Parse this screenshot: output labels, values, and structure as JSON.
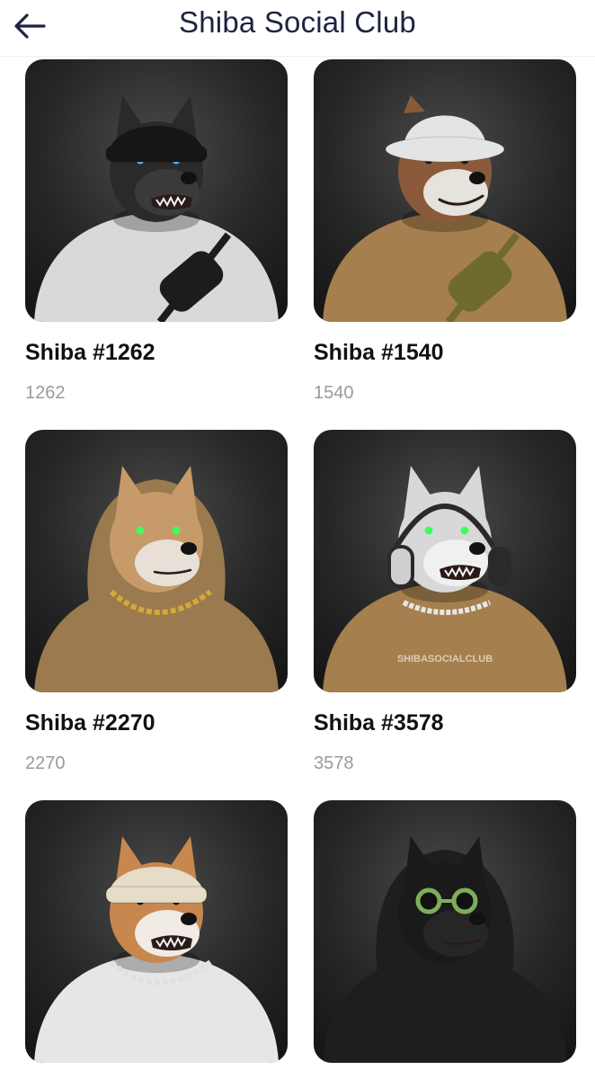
{
  "header": {
    "title": "Shiba Social Club",
    "back_icon": "arrow-left-icon"
  },
  "colors": {
    "title_text": "#1b2540",
    "card_title": "#111111",
    "card_subtitle": "#9a9a9a",
    "thumb_background": "#262626"
  },
  "items": [
    {
      "title": "Shiba #1262",
      "subtitle": "1262",
      "art": {
        "fur": "#2a2a2a",
        "muzzle": "#3a3a3a",
        "hat": "beanie",
        "hat_color": "#161616",
        "shirt": "#d9d9d9",
        "eyes": "#5ab4ff",
        "mouth": "snarl",
        "accessory": "bag",
        "accessory_color": "#1c1c1c"
      }
    },
    {
      "title": "Shiba #1540",
      "subtitle": "1540",
      "art": {
        "fur": "#8a5a3a",
        "muzzle": "#e6e2dc",
        "hat": "bucket",
        "hat_color": "#e4e4e4",
        "shirt": "#a57f4d",
        "eyes": "#1a1a1a",
        "mouth": "smile",
        "accessory": "bag",
        "accessory_color": "#6f6a2e"
      }
    },
    {
      "title": "Shiba #2270",
      "subtitle": "2270",
      "art": {
        "fur": "#c79a6a",
        "muzzle": "#e8e0d6",
        "hat": "hood",
        "hat_color": "#9a7a4e",
        "shirt": "#9a7a4e",
        "eyes": "#3cff5a",
        "mouth": "closed",
        "accessory": "chain",
        "accessory_color": "#d4a93a"
      }
    },
    {
      "title": "Shiba #3578",
      "subtitle": "3578",
      "art": {
        "fur": "#d8d8d8",
        "muzzle": "#f0f0f0",
        "hat": "none",
        "hat_color": "#d8d8d8",
        "shirt": "#a57f4d",
        "eyes": "#3cff5a",
        "mouth": "snarl",
        "accessory": "headphones",
        "accessory_color": "#2a2a2a",
        "shirt_text": "SHIBASOCIALCLUB"
      }
    },
    {
      "title": "",
      "subtitle": "",
      "art": {
        "fur": "#c7874e",
        "muzzle": "#f0ebe4",
        "hat": "beanie",
        "hat_color": "#e6dcc8",
        "shirt": "#e6e6e6",
        "eyes": "#1a1a1a",
        "mouth": "snarl",
        "accessory": "chain",
        "accessory_color": "#e0e0e0"
      }
    },
    {
      "title": "",
      "subtitle": "",
      "art": {
        "fur": "#1a1a1a",
        "muzzle": "#262626",
        "hat": "hood",
        "hat_color": "#1e1e1e",
        "shirt": "#1e1e1e",
        "eyes": "#1a1a1a",
        "mouth": "closed",
        "accessory": "glasses",
        "accessory_color": "#7fae5a"
      }
    }
  ]
}
